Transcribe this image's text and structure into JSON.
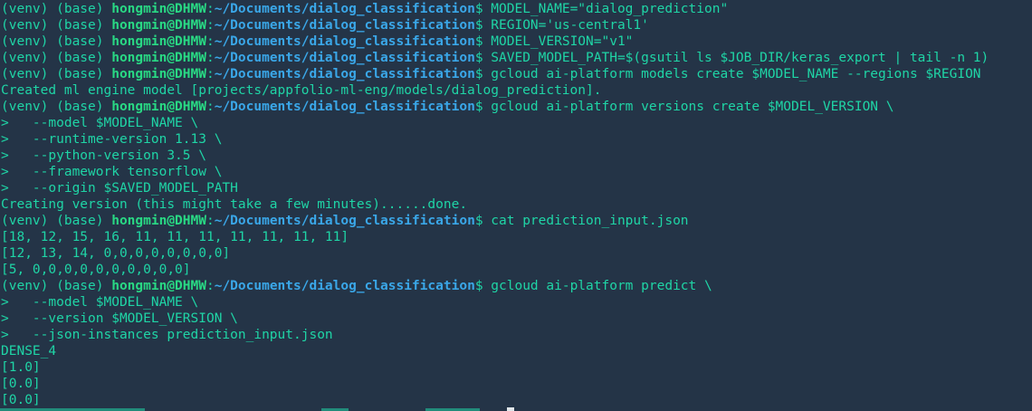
{
  "colors": {
    "background": "#243447",
    "text": "#1fd5a6",
    "user": "#29d984",
    "path": "#3aa7e8",
    "cursor": "#e0e6ea"
  },
  "prompt": {
    "venv": "(venv) (base) ",
    "user_host": "hongmin@DHMW",
    "sep": ":",
    "path": "~/Documents/dialog_classification",
    "symbol": "$ "
  },
  "lines": [
    {
      "type": "prompt",
      "cmd": "MODEL_NAME=\"dialog_prediction\""
    },
    {
      "type": "prompt",
      "cmd": "REGION='us-central1'"
    },
    {
      "type": "prompt",
      "cmd": "MODEL_VERSION=\"v1\""
    },
    {
      "type": "prompt",
      "cmd": "SAVED_MODEL_PATH=$(gsutil ls $JOB_DIR/keras_export | tail -n 1)"
    },
    {
      "type": "prompt",
      "cmd": "gcloud ai-platform models create $MODEL_NAME --regions $REGION"
    },
    {
      "type": "output",
      "text": "Created ml engine model [projects/appfolio-ml-eng/models/dialog_prediction]."
    },
    {
      "type": "prompt",
      "cmd": "gcloud ai-platform versions create $MODEL_VERSION \\"
    },
    {
      "type": "output",
      "text": ">   --model $MODEL_NAME \\"
    },
    {
      "type": "output",
      "text": ">   --runtime-version 1.13 \\"
    },
    {
      "type": "output",
      "text": ">   --python-version 3.5 \\"
    },
    {
      "type": "output",
      "text": ">   --framework tensorflow \\"
    },
    {
      "type": "output",
      "text": ">   --origin $SAVED_MODEL_PATH"
    },
    {
      "type": "output",
      "text": "Creating version (this might take a few minutes)......done."
    },
    {
      "type": "prompt",
      "cmd": "cat prediction_input.json"
    },
    {
      "type": "output",
      "text": "[18, 12, 15, 16, 11, 11, 11, 11, 11, 11, 11]"
    },
    {
      "type": "output",
      "text": "[12, 13, 14, 0,0,0,0,0,0,0,0]"
    },
    {
      "type": "output",
      "text": "[5, 0,0,0,0,0,0,0,0,0,0]"
    },
    {
      "type": "prompt",
      "cmd": "gcloud ai-platform predict \\"
    },
    {
      "type": "output",
      "text": ">   --model $MODEL_NAME \\"
    },
    {
      "type": "output",
      "text": ">   --version $MODEL_VERSION \\"
    },
    {
      "type": "output",
      "text": ">   --json-instances prediction_input.json"
    },
    {
      "type": "output",
      "text": "DENSE_4"
    },
    {
      "type": "output",
      "text": "[1.0]"
    },
    {
      "type": "output",
      "text": "[0.0]"
    },
    {
      "type": "output",
      "text": "[0.0]"
    }
  ]
}
